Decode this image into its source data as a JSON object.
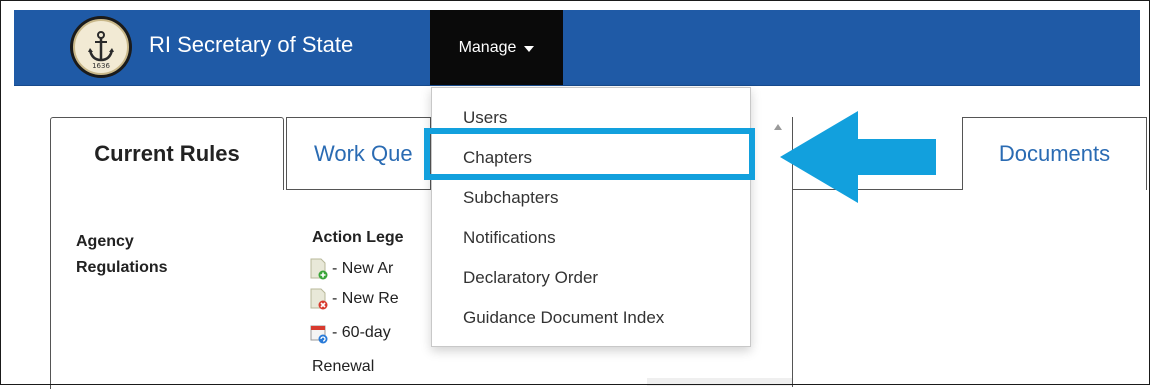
{
  "navbar": {
    "brand": "RI Secretary of State",
    "seal_year": "1636",
    "manage_label": "Manage",
    "bg_color": "#1f5aa6",
    "manage_bg": "#0a0a0a"
  },
  "tabs": {
    "current_rules": "Current Rules",
    "work_queue": "Work Que",
    "documents": "Documents"
  },
  "sidebar": {
    "agency_line1": "Agency",
    "agency_line2": "Regulations"
  },
  "legend": {
    "title": "Action Lege",
    "rows": [
      {
        "label": "- New Ar",
        "icon": "new-document-plus-icon"
      },
      {
        "label": "- New Re",
        "icon": "new-document-remove-icon"
      },
      {
        "label": "- 60-day",
        "icon": "calendar-refresh-icon"
      }
    ],
    "renewal": "Renewal"
  },
  "dropdown": {
    "items": [
      "Users",
      "Chapters",
      "Subchapters",
      "Notifications",
      "Declaratory Order",
      "Guidance Document Index"
    ],
    "highlighted": "Chapters",
    "highlight_color": "#12a0dd"
  }
}
